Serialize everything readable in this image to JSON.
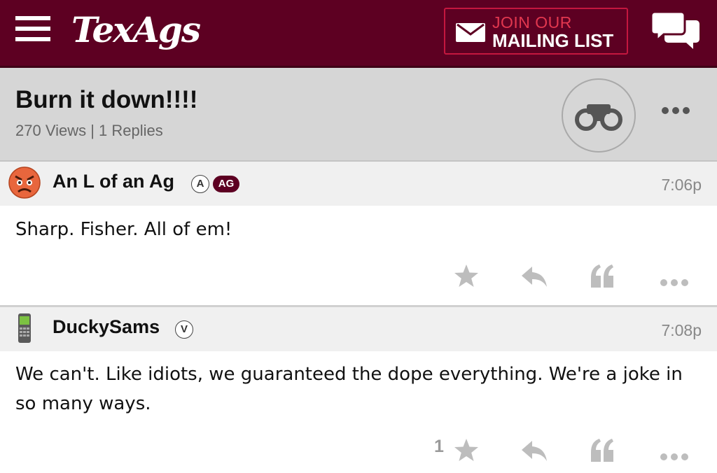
{
  "header": {
    "logo_text": "TexAgs",
    "mailing_line1": "JOIN OUR",
    "mailing_line2": "MAILING LIST",
    "icons": [
      "menu-icon",
      "mail-icon",
      "chat-bubbles-icon"
    ],
    "brand_color": "#5d0022",
    "accent_color": "#e2374f"
  },
  "thread": {
    "title": "Burn it down!!!!",
    "meta": "270 Views | 1 Replies",
    "icons": [
      "binoculars-icon",
      "more-icon"
    ]
  },
  "posts": [
    {
      "username": "An L of an Ag",
      "badges": [
        "A",
        "AG"
      ],
      "time": "7:06p",
      "body": "Sharp. Fisher. All of em!",
      "star_count": "",
      "avatar_icon": "angry-face-icon"
    },
    {
      "username": "DuckySams",
      "badges": [
        "V"
      ],
      "time": "7:08p",
      "body": "We can't. Like idiots, we guaranteed the dope everything. We're a joke in so many ways.",
      "star_count": "1",
      "avatar_icon": "cell-phone-icon"
    }
  ],
  "post_actions": [
    "star-icon",
    "reply-icon",
    "quote-icon",
    "more-icon"
  ]
}
